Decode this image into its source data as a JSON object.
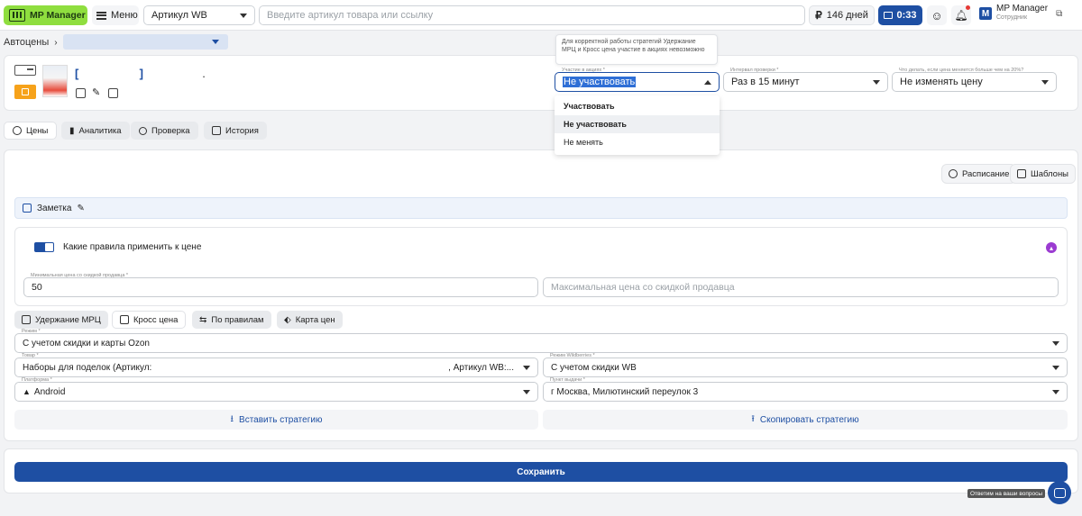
{
  "topbar": {
    "logo": "MP Manager",
    "menu": "Меню",
    "search_type": "Артикул WB",
    "search_placeholder": "Введите артикул товара или ссылку",
    "days": "146 дней",
    "timer": "0:33",
    "user_name": "MP Manager",
    "user_role": "Сотрудник",
    "user_initial": "M"
  },
  "breadcrumb": {
    "root": "Автоцены"
  },
  "product": {
    "brackets_open": "[",
    "brackets_close": "]",
    "dot": "."
  },
  "settings": {
    "tooltip": "Для корректной работы стратегий Удержание МРЦ и Кросс цена участие в акциях невозможно",
    "promo_label": "Участие в акциях *",
    "promo_value": "Не участвовать",
    "promo_options": [
      "Участвовать",
      "Не участвовать",
      "Не менять"
    ],
    "interval_label": "Интервал проверки *",
    "interval_value": "Раз в 15 минут",
    "change_label": "Что делать, если цена меняется больше чем на 20%?",
    "change_value": "Не изменять цену"
  },
  "tabs": [
    "Цены",
    "Аналитика",
    "Проверка",
    "История"
  ],
  "main": {
    "schedule": "Расписание",
    "templates": "Шаблоны",
    "note": "Заметка",
    "rules_title": "Какие правила применить к цене",
    "min_label": "Минимальная цена со скидкой продавца *",
    "min_value": "50",
    "max_placeholder": "Максимальная цена со скидкой продавца",
    "strategies": [
      "Удержание МРЦ",
      "Кросс цена",
      "По правилам",
      "Карта цен"
    ],
    "mode_label": "Режим *",
    "mode_value": "С учетом скидки и карты Ozon",
    "product_label": "Товар *",
    "product_value": "Наборы для поделок (Артикул:",
    "product_value_2": ", Артикул WB:...",
    "wb_mode_label": "Режим Wildberries *",
    "wb_mode_value": "С учетом скидки WB",
    "platform_label": "Платформа *",
    "platform_value": "Android",
    "pickup_label": "Пункт выдачи *",
    "pickup_value": "г Москва, Милютинский переулок 3",
    "insert": "Вставить стратегию",
    "copy": "Скопировать стратегию",
    "save": "Сохранить"
  },
  "help": {
    "tip": "Ответим на ваши вопросы"
  },
  "colors": {
    "accent": "#1e4fa3",
    "brand": "#8fde3f",
    "orange": "#f6a21a"
  }
}
